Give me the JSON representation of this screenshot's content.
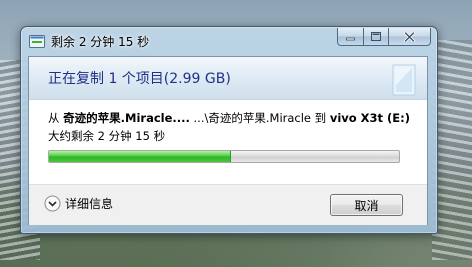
{
  "window": {
    "title": "剩余 2 分钟 15 秒",
    "minimize_icon": "minimize-icon",
    "maximize_icon": "maximize-icon",
    "close_icon": "close-icon"
  },
  "header": {
    "title": "正在复制 1 个项目(2.99 GB)"
  },
  "transfer": {
    "from_label": "从",
    "source_name": "奇迹的苹果.Miracle....",
    "source_path": "...\\奇迹的苹果.Miracle",
    "to_label": "到",
    "destination": "vivo X3t (E:)",
    "time_remaining": "大约剩余 2 分钟 15 秒",
    "progress_fraction": 0.52
  },
  "footer": {
    "details_label": "详细信息",
    "cancel_label": "取消"
  },
  "colors": {
    "header_title": "#1e3287",
    "progress_green": "#2fb52a"
  }
}
